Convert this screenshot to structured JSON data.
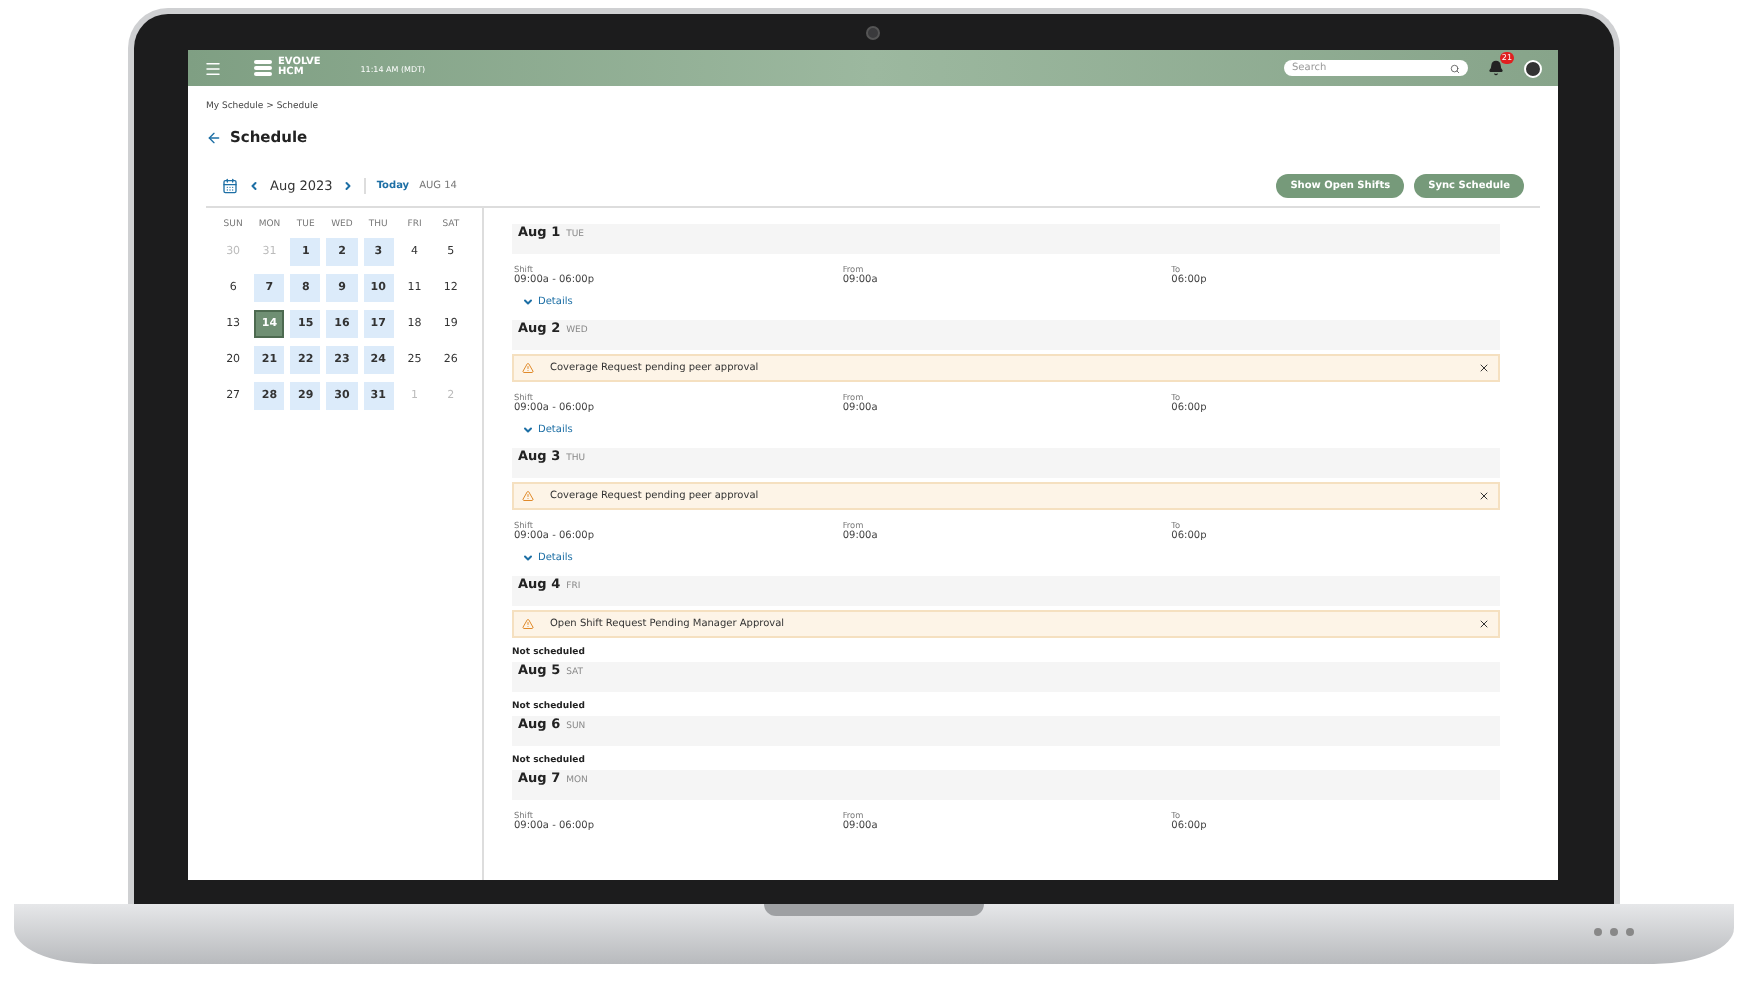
{
  "topbar": {
    "logo_lines": [
      "EVOLVE",
      "HCM"
    ],
    "time": "11:14 AM (MDT)",
    "search": {
      "placeholder": "Search"
    },
    "notifications": "21"
  },
  "breadcrumb": [
    "My Schedule",
    "Schedule"
  ],
  "breadcrumb_separator": ">",
  "title": "Schedule",
  "toolbar": {
    "month": "Aug 2023",
    "today": "Today",
    "date": "AUG 14",
    "buttons": [
      "Show Open Shifts",
      "Sync Schedule"
    ]
  },
  "calendar": {
    "weekdays": [
      "SUN",
      "MON",
      "TUE",
      "WED",
      "THU",
      "FRI",
      "SAT"
    ],
    "days": [
      {
        "label": "30",
        "kind": "outside",
        "selected": false
      },
      {
        "label": "31",
        "kind": "outside",
        "selected": false
      },
      {
        "label": "1",
        "kind": "scheduled",
        "selected": false
      },
      {
        "label": "2",
        "kind": "scheduled",
        "selected": false
      },
      {
        "label": "3",
        "kind": "scheduled",
        "selected": false
      },
      {
        "label": "4",
        "kind": "plain",
        "selected": false
      },
      {
        "label": "5",
        "kind": "plain",
        "selected": false
      },
      {
        "label": "6",
        "kind": "plain",
        "selected": false
      },
      {
        "label": "7",
        "kind": "scheduled",
        "selected": false
      },
      {
        "label": "8",
        "kind": "scheduled",
        "selected": false
      },
      {
        "label": "9",
        "kind": "scheduled",
        "selected": false
      },
      {
        "label": "10",
        "kind": "scheduled",
        "selected": false
      },
      {
        "label": "11",
        "kind": "plain",
        "selected": false
      },
      {
        "label": "12",
        "kind": "plain",
        "selected": false
      },
      {
        "label": "13",
        "kind": "plain",
        "selected": false
      },
      {
        "label": "14",
        "kind": "scheduled",
        "selected": true
      },
      {
        "label": "15",
        "kind": "scheduled",
        "selected": false
      },
      {
        "label": "16",
        "kind": "scheduled",
        "selected": false
      },
      {
        "label": "17",
        "kind": "scheduled",
        "selected": false
      },
      {
        "label": "18",
        "kind": "plain",
        "selected": false
      },
      {
        "label": "19",
        "kind": "plain",
        "selected": false
      },
      {
        "label": "20",
        "kind": "plain",
        "selected": false
      },
      {
        "label": "21",
        "kind": "scheduled",
        "selected": false
      },
      {
        "label": "22",
        "kind": "scheduled",
        "selected": false
      },
      {
        "label": "23",
        "kind": "scheduled",
        "selected": false
      },
      {
        "label": "24",
        "kind": "scheduled",
        "selected": false
      },
      {
        "label": "25",
        "kind": "plain",
        "selected": false
      },
      {
        "label": "26",
        "kind": "plain",
        "selected": false
      },
      {
        "label": "27",
        "kind": "plain",
        "selected": false
      },
      {
        "label": "28",
        "kind": "scheduled",
        "selected": false
      },
      {
        "label": "29",
        "kind": "scheduled",
        "selected": false
      },
      {
        "label": "30",
        "kind": "scheduled",
        "selected": false
      },
      {
        "label": "31",
        "kind": "scheduled",
        "selected": false
      },
      {
        "label": "1",
        "kind": "outside",
        "selected": false
      },
      {
        "label": "2",
        "kind": "outside",
        "selected": false
      }
    ]
  },
  "schedule": [
    {
      "date": "Aug 1",
      "weekday": "TUE",
      "kind": "shift",
      "shift": {
        "labels": [
          "Shift",
          "From",
          "To"
        ],
        "values": [
          "09:00a - 06:00p",
          "09:00a",
          "06:00p"
        ]
      },
      "details": "Details"
    },
    {
      "date": "Aug 2",
      "weekday": "WED",
      "alert": "Coverage Request pending peer approval",
      "kind": "shift",
      "shift": {
        "labels": [
          "Shift",
          "From",
          "To"
        ],
        "values": [
          "09:00a - 06:00p",
          "09:00a",
          "06:00p"
        ]
      },
      "details": "Details"
    },
    {
      "date": "Aug 3",
      "weekday": "THU",
      "alert": "Coverage Request pending peer approval",
      "kind": "shift",
      "shift": {
        "labels": [
          "Shift",
          "From",
          "To"
        ],
        "values": [
          "09:00a - 06:00p",
          "09:00a",
          "06:00p"
        ]
      },
      "details": "Details"
    },
    {
      "date": "Aug 4",
      "weekday": "FRI",
      "alert": "Open Shift Request Pending Manager Approval",
      "kind": "unscheduled",
      "note": "Not scheduled"
    },
    {
      "date": "Aug 5",
      "weekday": "SAT",
      "kind": "unscheduled",
      "note": "Not scheduled"
    },
    {
      "date": "Aug 6",
      "weekday": "SUN",
      "kind": "unscheduled",
      "note": "Not scheduled"
    },
    {
      "date": "Aug 7",
      "weekday": "MON",
      "kind": "shift",
      "shift": {
        "labels": [
          "Shift",
          "From",
          "To"
        ],
        "values": [
          "09:00a - 06:00p",
          "09:00a",
          "06:00p"
        ]
      }
    }
  ]
}
